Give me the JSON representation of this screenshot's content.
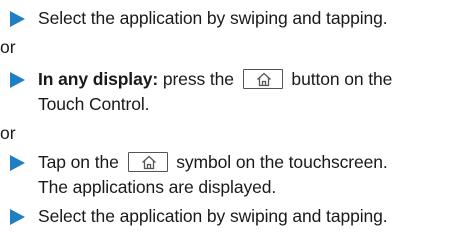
{
  "steps": {
    "s1": {
      "text": "Select the application by swiping and tapping."
    },
    "s2": {
      "bold": "In any display:",
      "before_icon": " press the ",
      "after_icon": " button on the",
      "line2": "Touch Control."
    },
    "s3": {
      "before_icon": "Tap on the ",
      "after_icon": " symbol on the touchscreen.",
      "line2": "The applications are displayed."
    },
    "s4": {
      "text": "Select the application by swiping and tapping."
    }
  },
  "separators": {
    "or1": "or",
    "or2": "or"
  },
  "icons": {
    "step_marker": "right-triangle-arrow-icon",
    "home_key": "home-icon"
  },
  "colors": {
    "arrow": "#1f7fc2",
    "text": "#1a1a1a",
    "key_border": "#555555"
  }
}
